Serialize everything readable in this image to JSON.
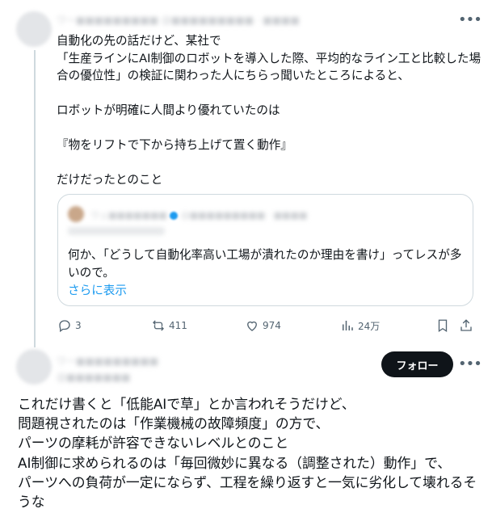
{
  "tweet1": {
    "author_name": "ワー■■■■■■■■■",
    "author_meta": "@■■■■■■■■■ · ■■■■",
    "body": "自動化の先の話だけど、某社で\n「生産ラインにAI制御のロボットを導入した際、平均的なライン工と比較した場合の優位性」の検証に関わった人にちらっ聞いたところによると、\n\nロボットが明確に人間より優れていたのは\n\n『物をリフトで下から持ち上げて置く動作』\n\nだけだったとのこと",
    "quote": {
      "author_name": "ウェ■■■■■■■",
      "author_meta": "@■■■■■■■■■ · ■■■■",
      "body": "何か、「どうして自動化率高い工場が潰れたのか理由を書け」ってレスが多いので。",
      "show_more": "さらに表示"
    },
    "stats": {
      "replies": "3",
      "retweets": "411",
      "likes": "974",
      "views": "24万"
    }
  },
  "tweet2": {
    "author_name": "ワー■■■■■■■■■",
    "author_meta": "@■■■■■■■",
    "follow_label": "フォロー",
    "body": "これだけ書くと「低能AIで草」とか言われそうだけど、\n問題視されたのは「作業機械の故障頻度」の方で、\nパーツの摩耗が許容できないレベルとのこと\nAI制御に求められるのは「毎回微妙に異なる（調整された）動作」で、\nパーツへの負荷が一定にならず、工程を繰り返すと一気に劣化して壊れるそうな"
  },
  "icons": {
    "more": "more-dots-icon",
    "reply": "reply-icon",
    "retweet": "retweet-icon",
    "like": "heart-icon",
    "views": "views-chart-icon",
    "bookmark": "bookmark-icon",
    "share": "share-icon"
  },
  "colors": {
    "accent": "#1d9bf0",
    "text": "#0f1419",
    "secondary": "#536471",
    "border": "#cfd9de"
  }
}
